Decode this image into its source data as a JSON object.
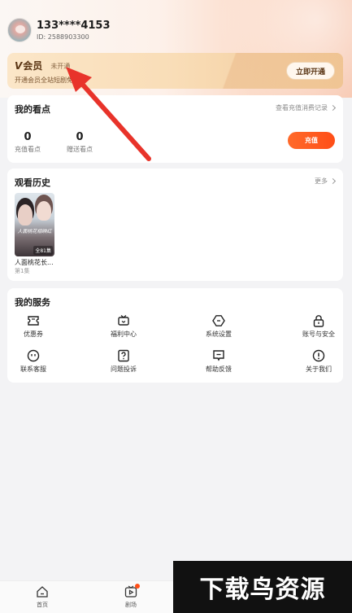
{
  "profile": {
    "phone": "133****4153",
    "uid": "ID: 2588903300"
  },
  "vip": {
    "logo_mark": "V",
    "title": "会员",
    "status": "未开通",
    "description": "开通会员全站短剧免费看",
    "open_button": "立即开通"
  },
  "points": {
    "title": "我的看点",
    "link": "查看充值消费记录",
    "recharge": {
      "value": "0",
      "label": "充值看点"
    },
    "gift": {
      "value": "0",
      "label": "赠送看点"
    },
    "recharge_button": "充值"
  },
  "history": {
    "title": "观看历史",
    "more": "更多",
    "items": [
      {
        "title": "人面桃花长...",
        "episode": "第1集",
        "poster_text": "人面桃花相映红",
        "badge": "全81集"
      }
    ]
  },
  "services": {
    "title": "我的服务",
    "items": [
      {
        "label": "优惠券",
        "icon": "ticket-icon"
      },
      {
        "label": "福利中心",
        "icon": "gift-tv-icon"
      },
      {
        "label": "系统设置",
        "icon": "settings-icon"
      },
      {
        "label": "账号与安全",
        "icon": "lock-icon"
      },
      {
        "label": "联系客服",
        "icon": "smile-icon"
      },
      {
        "label": "问题投诉",
        "icon": "question-icon"
      },
      {
        "label": "帮助反馈",
        "icon": "feedback-icon"
      },
      {
        "label": "关于我们",
        "icon": "info-icon"
      }
    ]
  },
  "nav": {
    "items": [
      {
        "label": "首页",
        "icon": "home-icon"
      },
      {
        "label": "剧场",
        "icon": "play-icon"
      }
    ]
  },
  "watermark": "下载鸟资源",
  "colors": {
    "accent": "#ff4e17",
    "vip_gold": "#f9ddb7",
    "vip_text": "#5a3514",
    "annotation_red": "#e8332a"
  }
}
